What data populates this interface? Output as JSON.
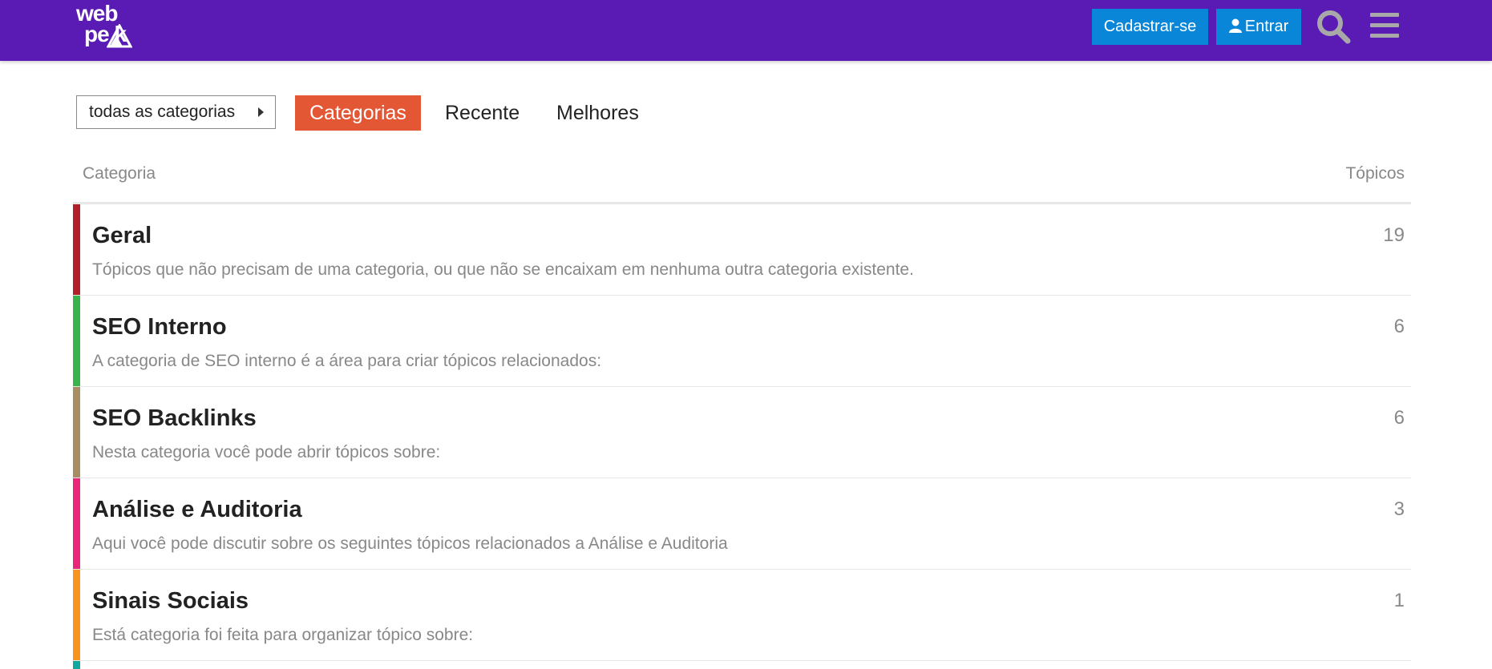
{
  "header": {
    "logo_line1": "web",
    "logo_line2": "pe  k",
    "signup_label": "Cadastrar-se",
    "login_label": "Entrar",
    "bg_color": "#5a1bb5",
    "button_color": "#0a86d8"
  },
  "nav": {
    "category_dropdown": "todas as categorias",
    "tabs": [
      {
        "label": "Categorias",
        "active": true
      },
      {
        "label": "Recente",
        "active": false
      },
      {
        "label": "Melhores",
        "active": false
      }
    ],
    "active_color": "#e45735"
  },
  "table": {
    "col_category": "Categoria",
    "col_topics": "Tópicos",
    "rows": [
      {
        "name": "Geral",
        "description": "Tópicos que não precisam de uma categoria, ou que não se encaixam em nenhuma outra categoria existente.",
        "topics": "19",
        "color": "#b3202a"
      },
      {
        "name": "SEO Interno",
        "description": "A categoria de SEO interno é a área para criar tópicos relacionados:",
        "topics": "6",
        "color": "#3ab44a"
      },
      {
        "name": "SEO Backlinks",
        "description": "Nesta categoria você pode abrir tópicos sobre:",
        "topics": "6",
        "color": "#a88d62"
      },
      {
        "name": "Análise e Auditoria",
        "description": "Aqui você pode discutir sobre os seguintes tópicos relacionados a Análise e Auditoria",
        "topics": "3",
        "color": "#e8267a"
      },
      {
        "name": "Sinais Sociais",
        "description": "Está categoria foi feita para organizar tópico sobre:",
        "topics": "1",
        "color": "#f7941d"
      }
    ],
    "next_row_color": "#12a89d"
  }
}
